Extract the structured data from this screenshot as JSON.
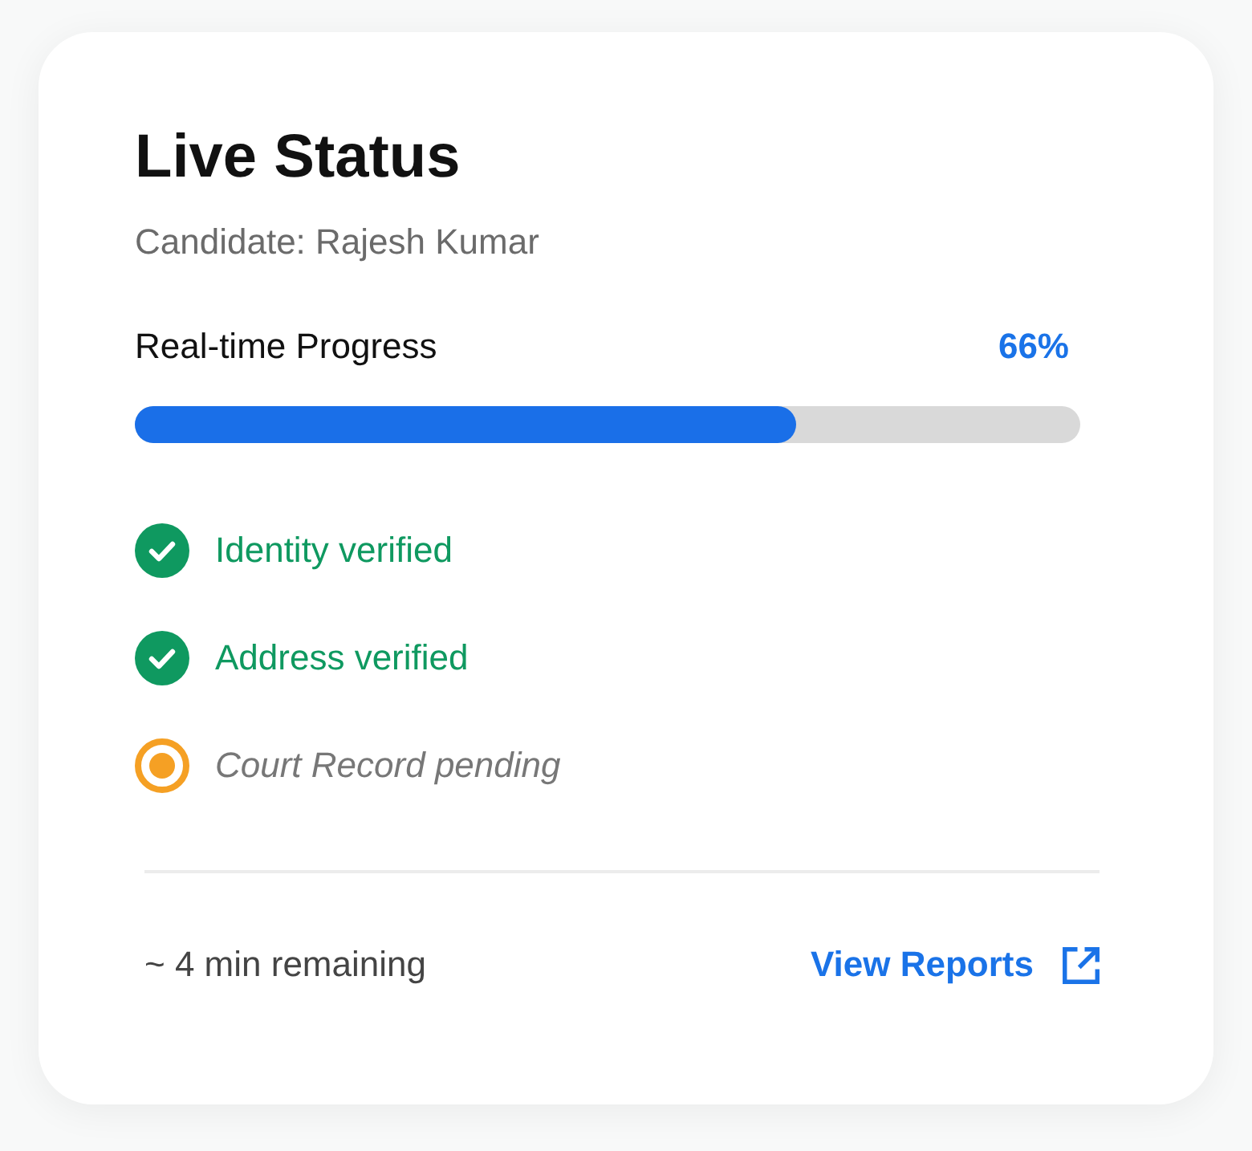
{
  "card": {
    "title": "Live Status",
    "subtitle": "Candidate: Rajesh Kumar",
    "progress": {
      "label": "Real-time Progress",
      "reading": "66%",
      "level": 0.7
    },
    "checks": [
      {
        "label": "Identity verified",
        "kind": "done"
      },
      {
        "label": "Address verified",
        "kind": "done"
      },
      {
        "label": "Court Record pending",
        "kind": "pending"
      }
    ],
    "footer": {
      "eta": "~ 4 min remaining",
      "link": "View Reports"
    }
  }
}
